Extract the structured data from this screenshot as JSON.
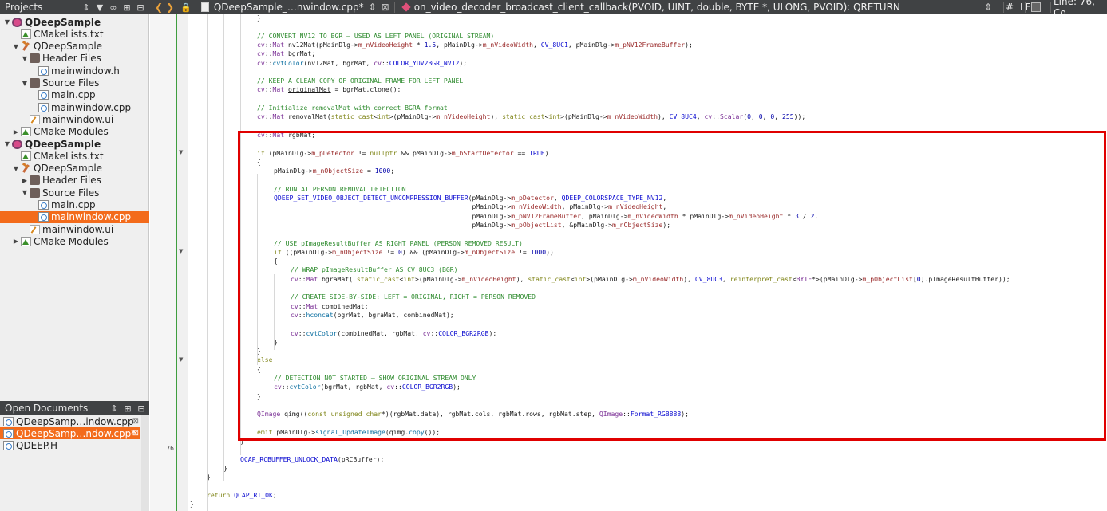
{
  "projects_pane": {
    "title": "Projects",
    "tree": [
      {
        "label": "QDeepSample",
        "bold": true,
        "icon": "qt-project-icon",
        "arrow": "down"
      },
      {
        "label": "CMakeLists.txt",
        "icon": "cmake-file-icon"
      },
      {
        "label": "QDeepSample",
        "icon": "hammer-icon",
        "arrow": "down"
      },
      {
        "label": "Header Files",
        "icon": "folder-icon",
        "arrow": "down"
      },
      {
        "label": "mainwindow.h",
        "icon": "header-file-icon"
      },
      {
        "label": "Source Files",
        "icon": "folder-icon",
        "arrow": "down"
      },
      {
        "label": "main.cpp",
        "icon": "cpp-file-icon"
      },
      {
        "label": "mainwindow.cpp",
        "icon": "cpp-file-icon"
      },
      {
        "label": "mainwindow.ui",
        "icon": "ui-file-icon"
      },
      {
        "label": "CMake Modules",
        "icon": "cmake-modules-icon",
        "arrow": "right"
      },
      {
        "label": "QDeepSample",
        "bold": true,
        "icon": "qt-project-icon",
        "arrow": "down"
      },
      {
        "label": "CMakeLists.txt",
        "icon": "cmake-file-icon"
      },
      {
        "label": "QDeepSample",
        "icon": "hammer-icon",
        "arrow": "down"
      },
      {
        "label": "Header Files",
        "icon": "folder-icon",
        "arrow": "right"
      },
      {
        "label": "Source Files",
        "icon": "folder-icon",
        "arrow": "down"
      },
      {
        "label": "main.cpp",
        "icon": "cpp-file-icon"
      },
      {
        "label": "mainwindow.cpp",
        "icon": "cpp-file-icon",
        "selected": true
      },
      {
        "label": "mainwindow.ui",
        "icon": "ui-file-icon"
      },
      {
        "label": "CMake Modules",
        "icon": "cmake-modules-icon",
        "arrow": "right"
      }
    ]
  },
  "open_documents": {
    "title": "Open Documents",
    "items": [
      {
        "label": "QDeepSamp…indow.cpp"
      },
      {
        "label": "QDeepSamp…ndow.cpp*",
        "selected": true
      },
      {
        "label": "QDEEP.H"
      }
    ]
  },
  "editor_toolbar": {
    "file_name": "QDeepSample_…nwindow.cpp*",
    "symbol": "on_video_decoder_broadcast_client_callback(PVOID, UINT, double, BYTE *, ULONG, PVOID): QRETURN",
    "hash": "#",
    "line_ending": "LF",
    "cursor_pos": "Line: 76, Co"
  },
  "gutter": {
    "current_line": "76"
  },
  "code_lines": [
    {
      "indent": 3,
      "html": "}"
    },
    {
      "indent": 0,
      "html": ""
    },
    {
      "indent": 3,
      "html": "<span class='cm'>// CONVERT NV12 TO BGR – USED AS LEFT PANEL (ORIGINAL STREAM)</span>"
    },
    {
      "indent": 3,
      "html": "<span class='ty'>cv</span>::<span class='ty'>Mat</span> nv12Mat(pMainDlg-><span class='mb'>m_nVideoHeight</span> * <span class='nu'>1.5</span>, pMainDlg-><span class='mb'>m_nVideoWidth</span>, <span class='mc'>CV_8UC1</span>, pMainDlg-><span class='mb'>m_pNV12FrameBuffer</span>);"
    },
    {
      "indent": 3,
      "html": "<span class='ty'>cv</span>::<span class='ty'>Mat</span> bgrMat;"
    },
    {
      "indent": 3,
      "html": "<span class='ty'>cv</span>::<span class='fn'>cvtColor</span>(nv12Mat, bgrMat, <span class='ty'>cv</span>::<span class='mc'>COLOR_YUV2BGR_NV12</span>);"
    },
    {
      "indent": 0,
      "html": ""
    },
    {
      "indent": 3,
      "html": "<span class='cm'>// KEEP A CLEAN COPY OF ORIGINAL FRAME FOR LEFT PANEL</span>"
    },
    {
      "indent": 3,
      "html": "<span class='ty'>cv</span>::<span class='ty'>Mat</span> <u>originalMat</u> = bgrMat.clone();"
    },
    {
      "indent": 0,
      "html": ""
    },
    {
      "indent": 3,
      "html": "<span class='cm'>// Initialize removalMat with correct BGRA format</span>"
    },
    {
      "indent": 3,
      "html": "<span class='ty'>cv</span>::<span class='ty'>Mat</span> <u>removalMat</u>(<span class='kw'>static_cast</span>&lt;<span class='kw'>int</span>&gt;(pMainDlg-><span class='mb'>m_nVideoHeight</span>), <span class='kw'>static_cast</span>&lt;<span class='kw'>int</span>&gt;(pMainDlg-><span class='mb'>m_nVideoWidth</span>), <span class='mc'>CV_8UC4</span>, <span class='ty'>cv</span>::<span class='ty'>Scalar</span>(<span class='nu'>0</span>, <span class='nu'>0</span>, <span class='nu'>0</span>, <span class='nu'>255</span>));"
    },
    {
      "indent": 0,
      "html": ""
    },
    {
      "indent": 3,
      "html": "<span class='ty'>cv</span>::<span class='ty'>Mat</span> rgbMat;"
    },
    {
      "indent": 0,
      "html": ""
    },
    {
      "indent": 3,
      "html": "<span class='kw'>if</span> (pMainDlg-><span class='mb'>m_pDetector</span> != <span class='kw'>nullptr</span> &amp;&amp; pMainDlg-><span class='mb'>m_bStartDetector</span> == <span class='mc'>TRUE</span>)"
    },
    {
      "indent": 3,
      "html": "{"
    },
    {
      "indent": 4,
      "html": "pMainDlg-><span class='mb'>m_nObjectSize</span> = <span class='nu'>1000</span>;"
    },
    {
      "indent": 0,
      "html": ""
    },
    {
      "indent": 4,
      "html": "<span class='cm'>// RUN AI PERSON REMOVAL DETECTION</span>"
    },
    {
      "indent": 4,
      "html": "<span class='mc'>QDEEP_SET_VIDEO_OBJECT_DETECT_UNCOMPRESSION_BUFFER</span>(pMainDlg-><span class='mb'>m_pDetector</span>, <span class='mc'>QDEEP_COLORSPACE_TYPE_NV12</span>,"
    },
    {
      "indent": 4,
      "html": "                                                   pMainDlg-><span class='mb'>m_nVideoWidth</span>, pMainDlg-><span class='mb'>m_nVideoHeight</span>,"
    },
    {
      "indent": 4,
      "html": "                                                   pMainDlg-><span class='mb'>m_pNV12FrameBuffer</span>, pMainDlg-><span class='mb'>m_nVideoWidth</span> * pMainDlg-><span class='mb'>m_nVideoHeight</span> * <span class='nu'>3</span> / <span class='nu'>2</span>,"
    },
    {
      "indent": 4,
      "html": "                                                   pMainDlg-><span class='mb'>m_pObjectList</span>, &amp;pMainDlg-><span class='mb'>m_nObjectSize</span>);"
    },
    {
      "indent": 0,
      "html": ""
    },
    {
      "indent": 4,
      "html": "<span class='cm'>// USE pImageResultBuffer AS RIGHT PANEL (PERSON REMOVED RESULT)</span>"
    },
    {
      "indent": 4,
      "html": "<span class='kw'>if</span> ((pMainDlg-><span class='mb'>m_nObjectSize</span> != <span class='nu'>0</span>) &amp;&amp; (pMainDlg-><span class='mb'>m_nObjectSize</span> != <span class='nu'>1000</span>))"
    },
    {
      "indent": 4,
      "html": "{"
    },
    {
      "indent": 5,
      "html": "<span class='cm'>// WRAP pImageResultBuffer AS CV_8UC3 (BGR)</span>"
    },
    {
      "indent": 5,
      "html": "<span class='ty'>cv</span>::<span class='ty'>Mat</span> bgraMat( <span class='kw'>static_cast</span>&lt;<span class='kw'>int</span>&gt;(pMainDlg-><span class='mb'>m_nVideoHeight</span>), <span class='kw'>static_cast</span>&lt;<span class='kw'>int</span>&gt;(pMainDlg-><span class='mb'>m_nVideoWidth</span>), <span class='mc'>CV_8UC3</span>, <span class='kw'>reinterpret_cast</span>&lt;<span class='ty'>BYTE</span>*&gt;(pMainDlg-><span class='mb'>m_pObjectList</span>[<span class='nu'>0</span>].pImageResultBuffer));"
    },
    {
      "indent": 0,
      "html": ""
    },
    {
      "indent": 5,
      "html": "<span class='cm'>// CREATE SIDE-BY-SIDE: LEFT = ORIGINAL, RIGHT = PERSON REMOVED</span>"
    },
    {
      "indent": 5,
      "html": "<span class='ty'>cv</span>::<span class='ty'>Mat</span> combinedMat;"
    },
    {
      "indent": 5,
      "html": "<span class='ty'>cv</span>::<span class='fn'>hconcat</span>(bgrMat, bgraMat, combinedMat);"
    },
    {
      "indent": 0,
      "html": ""
    },
    {
      "indent": 5,
      "html": "<span class='ty'>cv</span>::<span class='fn'>cvtColor</span>(combinedMat, rgbMat, <span class='ty'>cv</span>::<span class='mc'>COLOR_BGR2RGB</span>);"
    },
    {
      "indent": 4,
      "html": "}"
    },
    {
      "indent": 3,
      "html": "}"
    },
    {
      "indent": 3,
      "html": "<span class='kw'>else</span>"
    },
    {
      "indent": 3,
      "html": "{"
    },
    {
      "indent": 4,
      "html": "<span class='cm'>// DETECTION NOT STARTED – SHOW ORIGINAL STREAM ONLY</span>"
    },
    {
      "indent": 4,
      "html": "<span class='ty'>cv</span>::<span class='fn'>cvtColor</span>(bgrMat, rgbMat, <span class='ty'>cv</span>::<span class='mc'>COLOR_BGR2RGB</span>);"
    },
    {
      "indent": 3,
      "html": "}"
    },
    {
      "indent": 0,
      "html": ""
    },
    {
      "indent": 3,
      "html": "<span class='ty'>QImage</span> qimg((<span class='kw'>const unsigned char</span>*)(rgbMat.data), rgbMat.cols, rgbMat.rows, rgbMat.step, <span class='ty'>QImage</span>::<span class='mc'>Format_RGB888</span>);"
    },
    {
      "indent": 0,
      "html": ""
    },
    {
      "indent": 3,
      "html": "<span class='kw'>emit</span> pMainDlg-><span class='fn'>signal_UpdateImage</span>(qimg.<span class='fn'>copy</span>());"
    },
    {
      "indent": 2,
      "html": "}"
    },
    {
      "indent": 0,
      "html": ""
    },
    {
      "indent": 2,
      "html": "<span class='mc'>QCAP_RCBUFFER_UNLOCK_DATA</span>(pRCBuffer);"
    },
    {
      "indent": 1,
      "html": "}"
    },
    {
      "indent": 0,
      "html": "}"
    },
    {
      "indent": 0,
      "html": ""
    },
    {
      "indent": 0,
      "html": "<span class='kw'>return</span> <span class='mc'>QCAP_RT_OK</span>;"
    },
    {
      "indent": -1,
      "html": "}"
    }
  ],
  "colors": {
    "highlight_box": "#e00000",
    "selection": "#f36b1b",
    "bar_dark": "#404244"
  }
}
